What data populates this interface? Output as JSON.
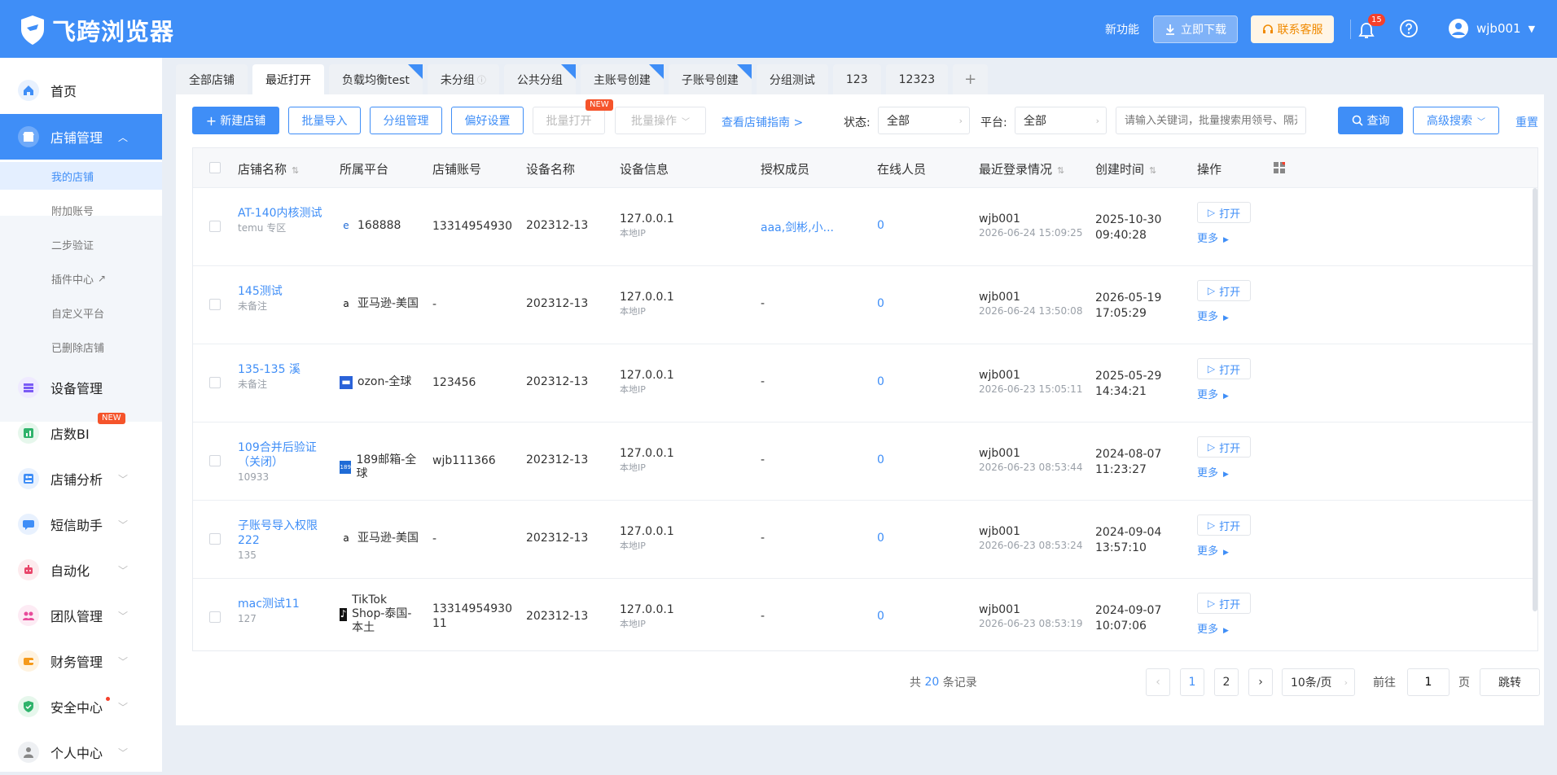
{
  "header": {
    "app_name": "飞跨浏览器",
    "new_features": "新功能",
    "download_label": "立即下载",
    "service_label": "联系客服",
    "notification_count": "15",
    "username": "wjb001"
  },
  "sidebar": {
    "home": "首页",
    "store_management": "店铺管理",
    "sub_items": [
      "我的店铺",
      "附加账号",
      "二步验证",
      "插件中心",
      "自定义平台",
      "已删除店铺"
    ],
    "device_management": "设备管理",
    "store_bi": "店数BI",
    "store_bi_badge": "NEW",
    "store_analysis": "店铺分析",
    "sms_assistant": "短信助手",
    "automation": "自动化",
    "team_management": "团队管理",
    "finance_management": "财务管理",
    "security_center": "安全中心",
    "personal_center": "个人中心"
  },
  "tabs": [
    "全部店铺",
    "最近打开",
    "负载均衡test",
    "未分组",
    "公共分组",
    "主账号创建",
    "子账号创建",
    "分组测试",
    "123",
    "12323"
  ],
  "toolbar": {
    "new_store": "新建店铺",
    "batch_import": "批量导入",
    "group_management": "分组管理",
    "preferences": "偏好设置",
    "batch_open": "批量打开",
    "batch_open_badge": "NEW",
    "batch_operations": "批量操作",
    "guide_link": "查看店铺指南 >",
    "status_label": "状态:",
    "status_value": "全部",
    "platform_label": "平台:",
    "platform_value": "全部",
    "search_placeholder": "请输入关键词，批量搜索用领号、隔开",
    "query_button": "查询",
    "advanced_search": "高级搜索",
    "reset": "重置"
  },
  "table": {
    "columns": [
      "店铺名称",
      "所属平台",
      "店铺账号",
      "设备名称",
      "设备信息",
      "授权成员",
      "在线人员",
      "最近登录情况",
      "创建时间",
      "操作"
    ],
    "rows": [
      {
        "name": "AT-140内核测试",
        "note": "temu 专区",
        "platform": "168888",
        "account": "13314954930",
        "device": "202312-13",
        "ip": "127.0.0.1",
        "ip_note": "本地IP",
        "members": "aaa,剑彬,小...",
        "online": "0",
        "login_user": "wjb001",
        "login_time": "2026-06-24 15:09:25",
        "created_date": "2025-10-30",
        "created_time": "09:40:28"
      },
      {
        "name": "145测试",
        "note": "未备注",
        "platform": "亚马逊-美国",
        "account": "-",
        "device": "202312-13",
        "ip": "127.0.0.1",
        "ip_note": "本地IP",
        "members": "-",
        "online": "0",
        "login_user": "wjb001",
        "login_time": "2026-06-24 13:50:08",
        "created_date": "2026-05-19",
        "created_time": "17:05:29"
      },
      {
        "name": "135-135 溪",
        "note": "未备注",
        "platform": "ozon-全球",
        "account": "123456",
        "device": "202312-13",
        "ip": "127.0.0.1",
        "ip_note": "本地IP",
        "members": "-",
        "online": "0",
        "login_user": "wjb001",
        "login_time": "2026-06-23 15:05:11",
        "created_date": "2025-05-29",
        "created_time": "14:34:21"
      },
      {
        "name": "109合并后验证（关闭）",
        "note": "10933",
        "platform": "189邮箱-全球",
        "account": "wjb111366",
        "device": "202312-13",
        "ip": "127.0.0.1",
        "ip_note": "本地IP",
        "members": "-",
        "online": "0",
        "login_user": "wjb001",
        "login_time": "2026-06-23 08:53:44",
        "created_date": "2024-08-07",
        "created_time": "11:23:27"
      },
      {
        "name": "子账号导入权限222",
        "note": "135",
        "platform": "亚马逊-美国",
        "account": "-",
        "device": "202312-13",
        "ip": "127.0.0.1",
        "ip_note": "本地IP",
        "members": "-",
        "online": "0",
        "login_user": "wjb001",
        "login_time": "2026-06-23 08:53:24",
        "created_date": "2024-09-04",
        "created_time": "13:57:10"
      },
      {
        "name": "mac测试11",
        "note": "127",
        "platform": "TikTok Shop-泰国-本土",
        "account": "1331495493011",
        "device": "202312-13",
        "ip": "127.0.0.1",
        "ip_note": "本地IP",
        "members": "-",
        "online": "0",
        "login_user": "wjb001",
        "login_time": "2026-06-23 08:53:19",
        "created_date": "2024-09-07",
        "created_time": "10:07:06"
      }
    ],
    "open_label": "打开",
    "more_label": "更多"
  },
  "pagination": {
    "total_prefix": "共",
    "total": "20",
    "total_suffix": "条记录",
    "page1": "1",
    "page2": "2",
    "page_size": "10条/页",
    "goto_prefix": "前往",
    "goto_value": "1",
    "goto_suffix": "页",
    "jump": "跳转"
  }
}
